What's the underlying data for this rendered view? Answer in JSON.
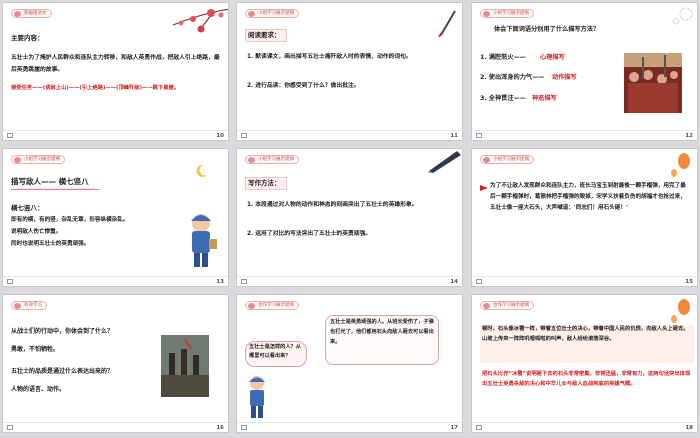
{
  "slides": [
    {
      "num": "10",
      "header": "部编版语文",
      "title": "主要内容：",
      "body": "五壮士为了掩护人民群众和连队主力转移，和敌人英勇作战，把敌人引上绝路，最后英勇跳崖的故事。",
      "plot": "接受任务——(诱敌上山)——(引上绝路)——(顶峰歼敌)——跳下悬崖。"
    },
    {
      "num": "11",
      "header": "小组学习展示提纲",
      "title": "阅读要求：",
      "items": [
        "1. 默读课文，画出描写五壮士痛歼敌人时的表情、动作的词句。",
        "2. 进行品读：你感受到了什么？做出批注。"
      ]
    },
    {
      "num": "12",
      "header": "小组学习展示提纲",
      "title": "体会下面词语分别用了什么描写方法？",
      "rows": [
        {
          "word": "1. 满腔怒火——",
          "method": "心理描写"
        },
        {
          "word": "2. 使出浑身的力气——",
          "method": "动作描写"
        },
        {
          "word": "3. 全神贯注——",
          "method": "神态描写"
        }
      ]
    },
    {
      "num": "13",
      "header": "小组学习展示提纲",
      "title": "描写敌人—— 横七竖八",
      "subtitle": "横七竖八：",
      "lines": [
        "即有的横，有的竖，杂乱无章，形容纵横杂乱。",
        "说明敌人伤亡惨重。",
        "同时也说明五壮士的英勇顽强。"
      ]
    },
    {
      "num": "14",
      "header": "小组学习展示提纲",
      "title": "写作方法：",
      "items": [
        "1. 本段通过对人物的动作和神态的刻画突出了五壮士的英雄形象。",
        "2. 运用了对比的写法突出了五壮士的英勇顽强。"
      ]
    },
    {
      "num": "15",
      "header": "小组学习展示提纲",
      "body": "为了不让敌人发现群众和连队主力，班长马宝玉到射最後一颗手榴弹，用完了最后一颗手榴弹时，葛振林把手榴弹的毁掉，宋学义扶着负伤的胡福才也抢过来，五壮士像一座大石头，大声喊道：'同志们！用石头砸！'"
    },
    {
      "num": "16",
      "header": "有效学习",
      "q1": "从战士们的行动中，你体会到了什么？",
      "a1": "勇敢，不怕牺牲。",
      "q2": "五壮士的品质是通过什么表达出来的？",
      "a2": "人物的语言、动作。"
    },
    {
      "num": "17",
      "header": "合作学习展示提纲",
      "bubble1": "五壮士是怎样的人？从哪里可以看出来？",
      "bubble2": "五壮士是英勇顽强的人。从班长受伤了，子弹也打光了，他们都用石头向敌人砸去可以看出来。"
    },
    {
      "num": "18",
      "header": "合作学习展示提纲",
      "p1": "顿时，石头像冰雹一样，带着五位壮士的决心，带着中国人民的仇恨，向敌人头上砸去。山坡上传来一阵阵叽哩呱啦的叫声，敌人纷纷滚落深谷。",
      "p2": "把石头比作“冰雹”说明砸下去的石头非常密集，非常迅猛，非常有力。这两句话突出体现出五壮士英勇杀敌的决心和中华儿女与敌人血战到底的英雄气概。"
    }
  ]
}
